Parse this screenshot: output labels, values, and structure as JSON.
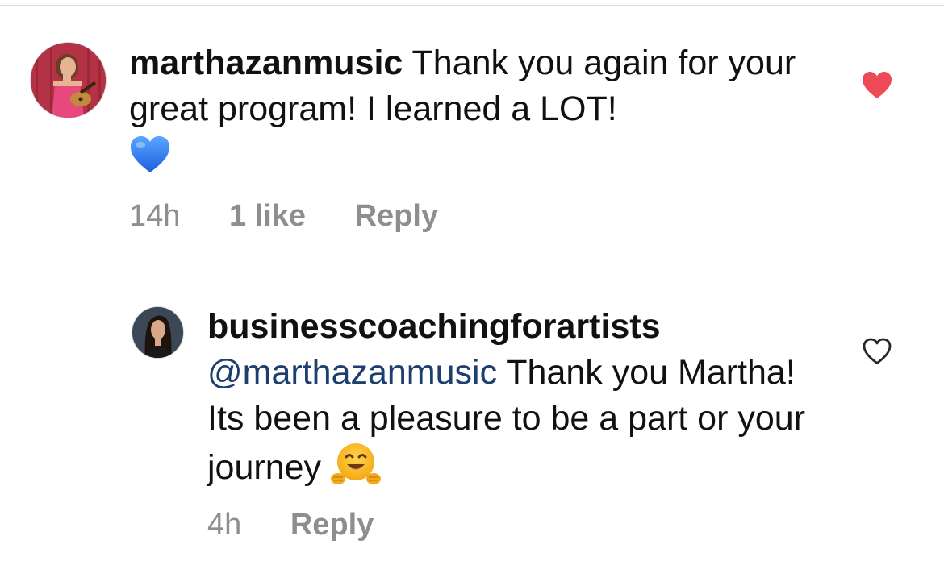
{
  "colors": {
    "text": "#111111",
    "muted": "#8e8e8e",
    "mention": "#1c3f6e",
    "liked_heart": "#ed4956",
    "unliked_heart": "#262626",
    "divider": "#dbdbdb"
  },
  "comments": [
    {
      "username": "marthazanmusic",
      "text": "Thank you again for your great program! I learned a LOT!",
      "emoji": "blue-heart-emoji",
      "time": "14h",
      "likes": "1 like",
      "reply_label": "Reply",
      "liked": true,
      "avatar": "avatar-woman-with-ukulele"
    }
  ],
  "reply": {
    "username": "businesscoachingforartists",
    "mention": "@marthazanmusic",
    "text": "Thank you Martha! Its been a pleasure to be a part or your journey",
    "emoji": "hugging-face-emoji",
    "time": "4h",
    "reply_label": "Reply",
    "liked": false,
    "avatar": "avatar-woman-portrait"
  }
}
